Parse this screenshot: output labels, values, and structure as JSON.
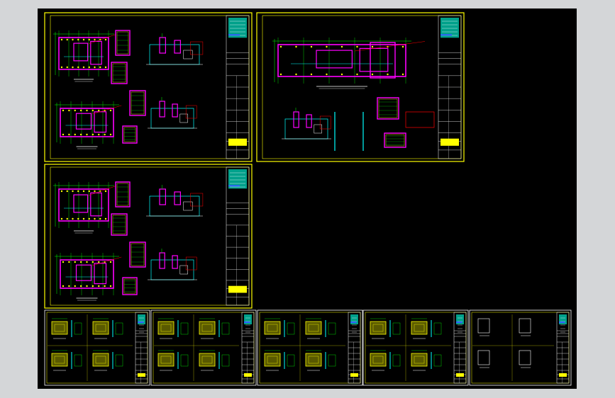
{
  "viewport": {
    "background": "#000000",
    "frame": "#d4d6d8"
  },
  "palette": {
    "sheet_border": "#ffff00",
    "title_block": "#ffffff",
    "logo": "#00a08a",
    "dim": "#00ff00",
    "wall": "#ff00ff",
    "detail": "#00ffff",
    "rebar": "#ff0000",
    "fill": "#ffff00",
    "text": "#ffffff"
  },
  "sheets": {
    "large": [
      {
        "id": "sheet-1"
      },
      {
        "id": "sheet-2"
      },
      {
        "id": "sheet-3"
      }
    ],
    "small": [
      {
        "id": "detail-sheet-1"
      },
      {
        "id": "detail-sheet-2"
      },
      {
        "id": "detail-sheet-3"
      },
      {
        "id": "detail-sheet-4"
      },
      {
        "id": "detail-sheet-5"
      }
    ]
  }
}
